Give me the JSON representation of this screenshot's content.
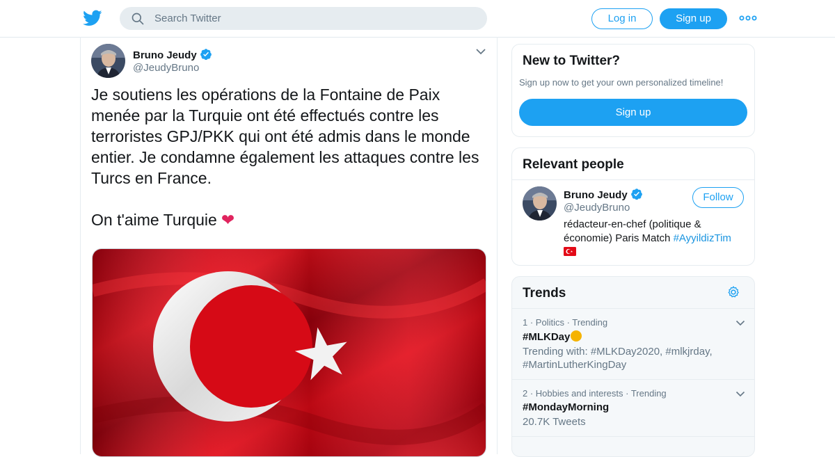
{
  "header": {
    "search_placeholder": "Search Twitter",
    "login_label": "Log in",
    "signup_label": "Sign up"
  },
  "tweet": {
    "author_name": "Bruno Jeudy",
    "author_handle": "@JeudyBruno",
    "text": "Je soutiens les opérations de la Fontaine de Paix menée par la Turquie ont été effectués contre les terroristes GPJ/PKK qui ont été admis dans le monde entier. Je condamne également les attaques contre les Turcs en France.\n\nOn t'aime Turquie",
    "emoji": "❤",
    "media": "turkish-flag-photo"
  },
  "new_to_twitter": {
    "title": "New to Twitter?",
    "subtitle": "Sign up now to get your own personalized timeline!",
    "signup_label": "Sign up"
  },
  "relevant_people": {
    "title": "Relevant people",
    "person": {
      "name": "Bruno Jeudy",
      "handle": "@JeudyBruno",
      "follow_label": "Follow",
      "bio": "rédacteur-en-chef (politique & économie) Paris Match ",
      "bio_tag": "#AyyildizTim"
    }
  },
  "trends": {
    "title": "Trends",
    "items": [
      {
        "meta": "1 · Politics · Trending",
        "tag": "#MLKDay",
        "sub": "Trending with: #MLKDay2020, #mlkjrday, #MartinLutherKingDay"
      },
      {
        "meta": "2 · Hobbies and interests · Trending",
        "tag": "#MondayMorning",
        "sub": "20.7K Tweets"
      }
    ]
  },
  "colors": {
    "brand": "#1da1f2",
    "text_secondary": "#657786",
    "heart": "#e0245e",
    "flag_red": "#e30a17"
  }
}
